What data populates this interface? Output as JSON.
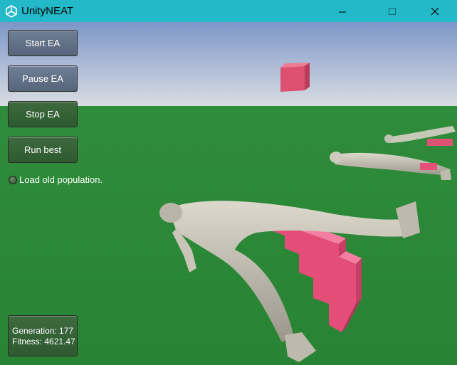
{
  "window": {
    "title": "UnityNEAT",
    "minimize_symbol": "—",
    "maximize_symbol": "□",
    "close_symbol": "✕"
  },
  "controls": {
    "start_label": "Start EA",
    "pause_label": "Pause EA",
    "stop_label": "Stop EA",
    "run_best_label": "Run best",
    "load_old_population_label": "Load old population.",
    "load_old_population_checked": false
  },
  "stats": {
    "generation_line": "Generation: 177",
    "fitness_line": "Fitness: 4621.47"
  },
  "colors": {
    "titlebar": "#23b9c9",
    "ground": "#2a8a3a",
    "target_cube": "#e05573",
    "stairs": "#e8507a"
  },
  "icons": {
    "app": "unity-logo-icon",
    "minimize": "minimize-icon",
    "maximize": "maximize-icon",
    "close": "close-icon"
  }
}
